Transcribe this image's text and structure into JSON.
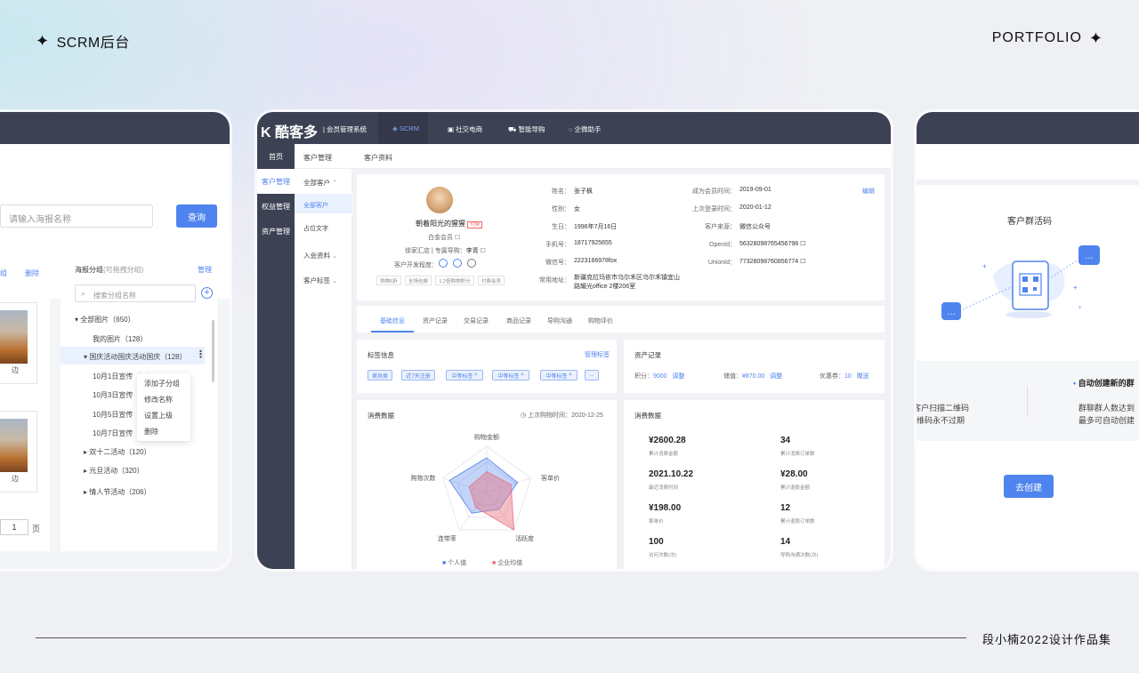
{
  "header": {
    "left_title": "SCRM后台",
    "right_title": "PORTFOLIO",
    "footer": "段小楠2022设计作品集"
  },
  "left": {
    "search_placeholder": "请输入海报名称",
    "search_btn": "查询",
    "group_actions": "分组",
    "group_delete": "删除",
    "panel_title": "海报分组",
    "panel_hint": "(可拖拽分组)",
    "manage": "管理",
    "group_search_placeholder": "搜索分组名称",
    "tree": [
      "全部图片（650）",
      "我的图片（128）",
      "国庆活动国庆活动国庆（128）",
      "10月1日宣传（45）",
      "10月3日宣传（45）",
      "10月5日宣传（45）",
      "10月7日宣传（45）",
      "双十二活动（120）",
      "元旦活动（320）",
      "情人节活动（206）"
    ],
    "menu": [
      "添加子分组",
      "修改名称",
      "设置上级",
      "删除"
    ],
    "thumb_caption": "边",
    "page_input": "1",
    "page_unit": "页"
  },
  "main": {
    "logo": "酷客多",
    "system": "会员管理系统",
    "nav": [
      "SCRM",
      "社交电商",
      "智能导购",
      "企微助手"
    ],
    "side": [
      "首页",
      "客户管理",
      "权益管理",
      "资产管理"
    ],
    "breadcrumb": [
      "客户管理",
      "客户资料"
    ],
    "sub": [
      "全部客户",
      "全部客户",
      "占位文字",
      "入会资料",
      "客户标签"
    ],
    "profile": {
      "nickname": "朝着阳光的猩猩",
      "badge": "付费",
      "level": "白金会员",
      "store": "徐家汇店 | 专属导购：",
      "guide": "李青",
      "dev": "客户开发程度：",
      "tags": [
        "购物6折",
        "全场包邮",
        "1.2倍购物积分",
        "付费会员"
      ]
    },
    "info_left": [
      [
        "姓名：",
        "张子枫"
      ],
      [
        "性别：",
        "女"
      ],
      [
        "生日：",
        "1996年7月16日"
      ],
      [
        "手机号：",
        "18717925655"
      ],
      [
        "微信号：",
        "2223166978fox"
      ],
      [
        "常用地址：",
        "新疆克拉玛依市乌尔禾区乌尔禾镇宜山路耀光office 2楼206室"
      ]
    ],
    "info_right": [
      [
        "成为会员时间：",
        "2019-09-01"
      ],
      [
        "上次登录时间：",
        "2020-01-12"
      ],
      [
        "客户来源：",
        "微信公众号"
      ],
      [
        "OpenId：",
        "563280987654567​98"
      ],
      [
        "UnionId：",
        "773280987608567​74"
      ]
    ],
    "edit": "编辑",
    "tabs": [
      "基础信息",
      "资产记录",
      "交易记录",
      "商品记录",
      "导购沟通",
      "购物评价"
    ],
    "tags_title": "标签信息",
    "tags_manage": "管理标签",
    "tags": [
      "美妆类",
      "近7天注册",
      "中等标签",
      "中等标签",
      "中等标签",
      "..."
    ],
    "asset_title": "资产记录",
    "asset": [
      [
        "积分：",
        "9000",
        "调整"
      ],
      [
        "储值：",
        "¥870.00",
        "调整"
      ],
      [
        "优惠券：",
        "10",
        "赠送"
      ]
    ],
    "consume_title": "消费数据",
    "last_buy": "上次购物时间：",
    "last_buy_date": "2020-12-25",
    "radar_labels": [
      "购物金额",
      "客单价",
      "活跃度",
      "连带率",
      "购物次数"
    ],
    "legend": [
      "个人值",
      "企业均值"
    ],
    "stats_title": "消费数据",
    "stats": [
      [
        "¥2600.28",
        "累计消费金额"
      ],
      [
        "34",
        "累计消费订单数"
      ],
      [
        "2021.10.22",
        "最近消费时间"
      ],
      [
        "¥28.00",
        "累计退款金额"
      ],
      [
        "¥198.00",
        "客单价"
      ],
      [
        "12",
        "累计退款订单数"
      ],
      [
        "100",
        "访问次数(次)"
      ],
      [
        "14",
        "导购沟通次数(次)"
      ]
    ]
  },
  "right": {
    "title": "客户群活码",
    "feature": "自动创建新的群",
    "line1": "客户扫描二维码",
    "line2": "维码永不过期",
    "line3": "群聊群人数达到",
    "line4": "最多可自动创建",
    "btn": "去创建"
  },
  "chart_data": {
    "type": "radar",
    "categories": [
      "购物金额",
      "客单价",
      "活跃度",
      "连带率",
      "购物次数"
    ],
    "series": [
      {
        "name": "个人值",
        "values": [
          75,
          70,
          45,
          55,
          85
        ]
      },
      {
        "name": "企业均值",
        "values": [
          45,
          55,
          100,
          40,
          40
        ]
      }
    ],
    "range": [
      0,
      100
    ]
  }
}
